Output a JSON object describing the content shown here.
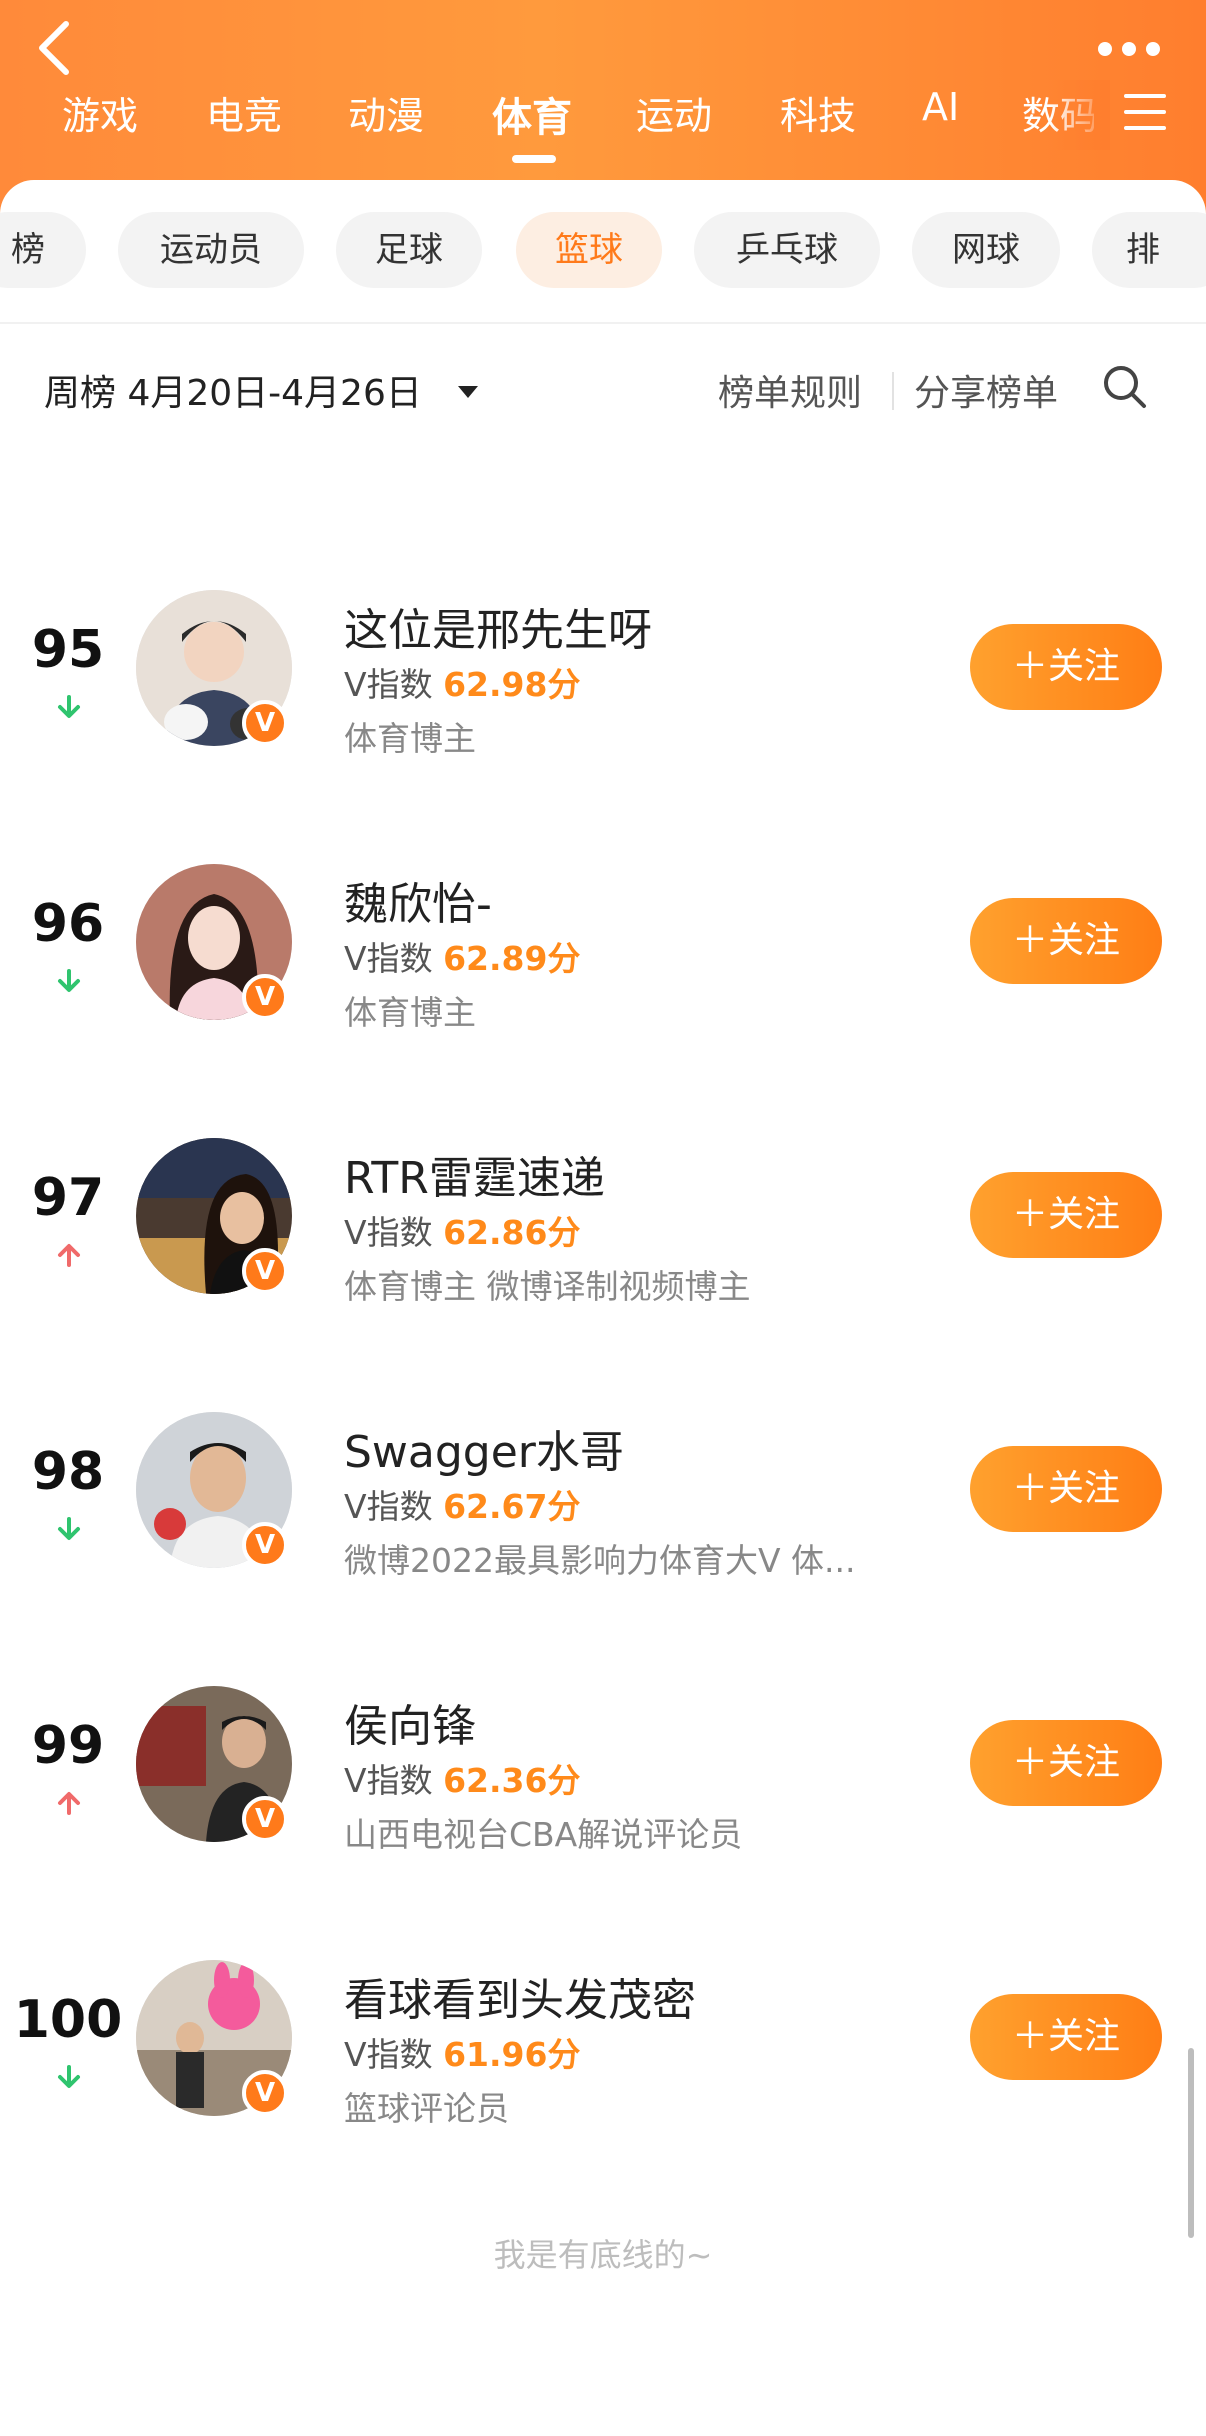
{
  "header": {
    "categories": [
      "游戏",
      "电竞",
      "动漫",
      "体育",
      "运动",
      "科技",
      "AI",
      "数码"
    ],
    "active_category": "体育"
  },
  "sub_tabs": {
    "items": [
      "榜",
      "运动员",
      "足球",
      "篮球",
      "乒乓球",
      "网球",
      "排"
    ],
    "active": "篮球"
  },
  "toolbar": {
    "period": "周榜 4月20日-4月26日",
    "rules": "榜单规则",
    "share": "分享榜单"
  },
  "colors": {
    "accent": "#ff7a1a",
    "trend_up": "#f06a6a",
    "trend_down": "#2fc46e"
  },
  "rankings": [
    {
      "rank": "95",
      "trend": "down",
      "name": "这位是邢先生呀",
      "vindex_label": "V指数",
      "score": "62.98分",
      "desc": "体育博主",
      "follow": "关注",
      "badge": "V"
    },
    {
      "rank": "96",
      "trend": "down",
      "name": "魏欣怡-",
      "vindex_label": "V指数",
      "score": "62.89分",
      "desc": "体育博主",
      "follow": "关注",
      "badge": "V"
    },
    {
      "rank": "97",
      "trend": "up",
      "name": "RTR雷霆速递",
      "vindex_label": "V指数",
      "score": "62.86分",
      "desc": "体育博主 微博译制视频博主",
      "follow": "关注",
      "badge": "V"
    },
    {
      "rank": "98",
      "trend": "down",
      "name": "Swagger水哥",
      "vindex_label": "V指数",
      "score": "62.67分",
      "desc": "微博2022最具影响力体育大V 体...",
      "follow": "关注",
      "badge": "V"
    },
    {
      "rank": "99",
      "trend": "up",
      "name": "侯向锋",
      "vindex_label": "V指数",
      "score": "62.36分",
      "desc": "山西电视台CBA解说评论员",
      "follow": "关注",
      "badge": "V"
    },
    {
      "rank": "100",
      "trend": "down",
      "name": "看球看到头发茂密",
      "vindex_label": "V指数",
      "score": "61.96分",
      "desc": "篮球评论员",
      "follow": "关注",
      "badge": "V"
    }
  ],
  "footer": {
    "text": "我是有底线的~"
  }
}
